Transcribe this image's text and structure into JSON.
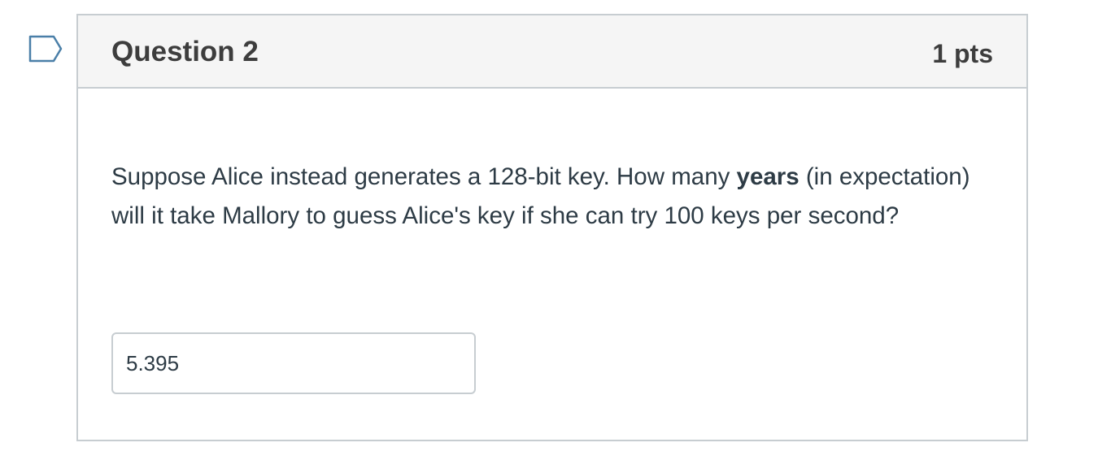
{
  "question": {
    "title": "Question 2",
    "points": "1 pts",
    "text_before": "Suppose Alice instead generates a 128-bit key. How many ",
    "text_bold": "years",
    "text_after": " (in expectation) will it take Mallory to guess Alice's key if she can try 100 keys per second?",
    "answer_value": "5.395"
  },
  "icons": {
    "flag": "flag-question-icon"
  },
  "colors": {
    "flag_stroke": "#4a7fa8",
    "border": "#c7cdd1",
    "header_bg": "#f5f5f5",
    "text": "#2d3b45"
  }
}
